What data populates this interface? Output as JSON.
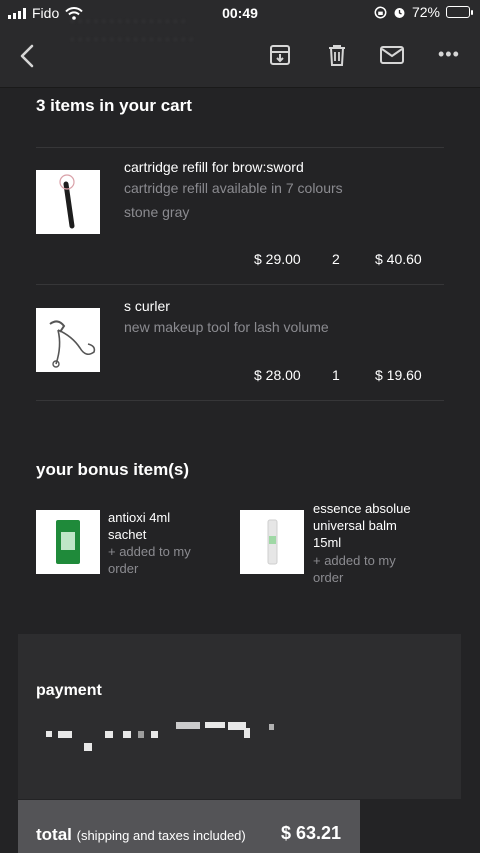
{
  "status_bar": {
    "carrier": "Fido",
    "time": "00:49",
    "battery_percent": "72%",
    "battery_level": 0.72
  },
  "toolbar": {
    "back_icon": "chevron-left-icon",
    "archive_icon": "archive-icon",
    "delete_icon": "trash-icon",
    "mark_icon": "envelope-icon",
    "more_icon": "more-horizontal-icon"
  },
  "cart": {
    "heading": "3 items in your cart",
    "items": [
      {
        "name": "cartridge refill for brow:sword",
        "desc1": "cartridge refill available in 7 colours",
        "desc2": "stone gray",
        "price": "$ 29.00",
        "qty": "2",
        "total": "$ 40.60"
      },
      {
        "name": "s curler",
        "desc1": "new makeup tool for lash volume",
        "price": "$ 28.00",
        "qty": "1",
        "total": "$ 19.60"
      }
    ]
  },
  "bonus": {
    "heading": "your bonus item(s)",
    "items": [
      {
        "name_line1": "antioxi 4ml",
        "name_line2": "sachet",
        "added_line1": "+ added to my",
        "added_line2": "order"
      },
      {
        "name_line1": "essence absolue",
        "name_line2": "universal balm",
        "name_line3": "15ml",
        "added_line1": "+ added to my",
        "added_line2": "order"
      }
    ]
  },
  "payment": {
    "heading": "payment"
  },
  "total": {
    "label": "total",
    "note": "(shipping and taxes included)",
    "value": "$ 63.21"
  },
  "colors": {
    "background": "#232325",
    "toolbar": "#2a2a2c",
    "muted_text": "#8b8b90",
    "payment_panel": "#2d2d2f",
    "total_bar": "#545457"
  }
}
